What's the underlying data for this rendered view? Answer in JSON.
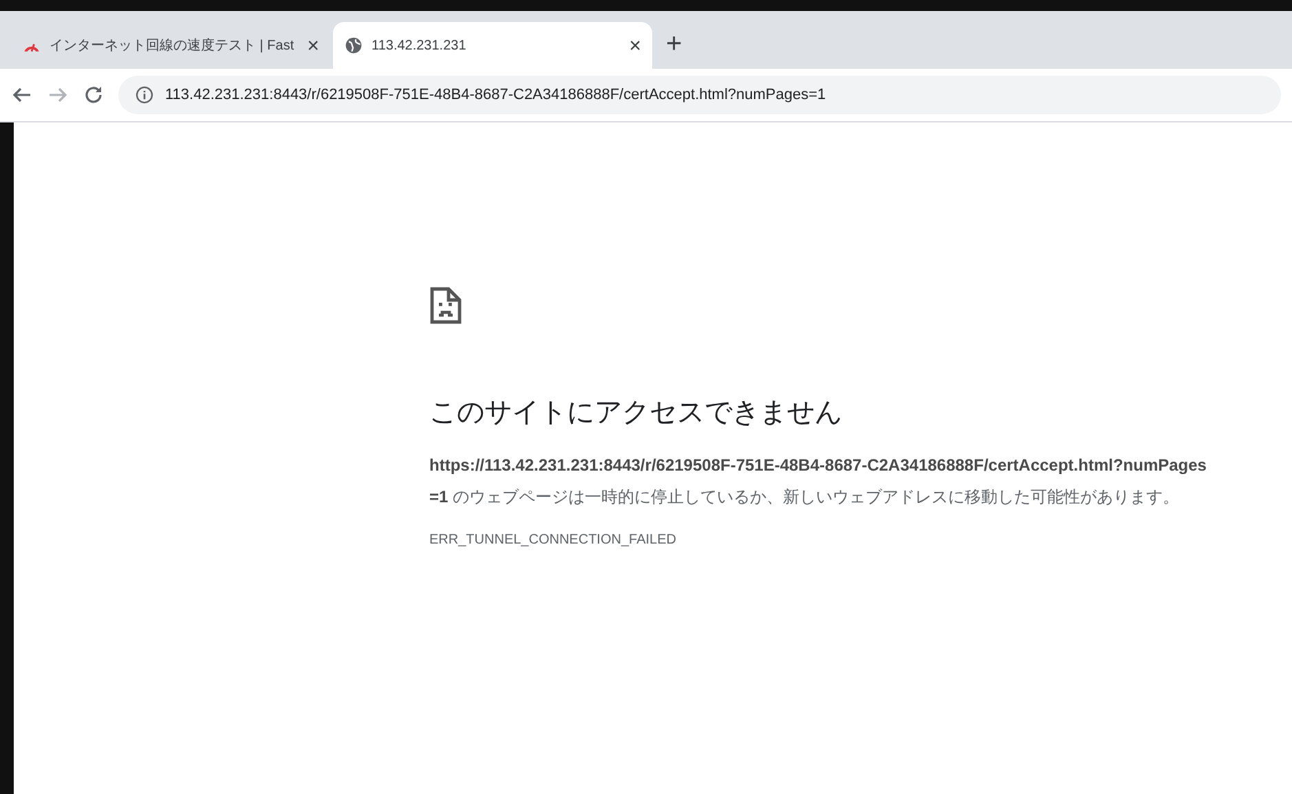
{
  "tabs": [
    {
      "kind": "speed",
      "title": "インターネット回線の速度テスト | Fast",
      "selected": false,
      "close": "×"
    },
    {
      "kind": "globe",
      "title": "113.42.231.231",
      "selected": true,
      "close": "×"
    }
  ],
  "new_tab": "+",
  "toolbar": {
    "address": "113.42.231.231:8443/r/6219508F-751E-48B4-8687-C2A34186888F/certAccept.html?numPages=1"
  },
  "error_page": {
    "heading": "このサイトにアクセスできません",
    "message": "**https://113.42.231.231:8443/r/6219508F-751E-48B4-8687-C2A34186888F/certAccept.html?numPages=1** のウェブページは一時的に停止しているか、新しいウェブアドレスに移動した可能性があります。",
    "code": "ERR_TUNNEL_CONNECTION_FAILED"
  }
}
